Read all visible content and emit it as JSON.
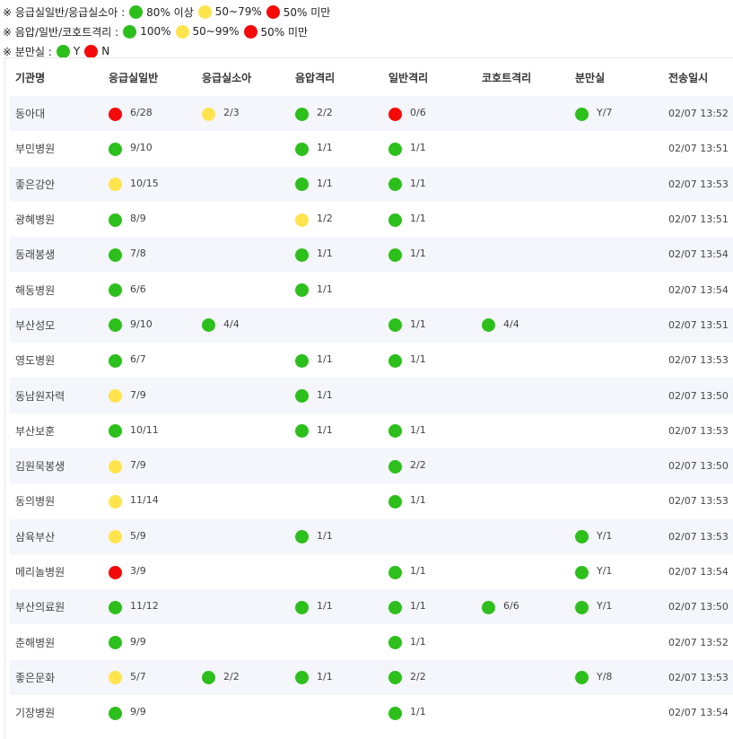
{
  "colors": {
    "green": "#2dbf1c",
    "yellow": "#ffe44d",
    "red": "#f50a0a"
  },
  "legend": [
    {
      "title": "※ 응급실일반/응급실소아 :",
      "items": [
        {
          "color": "green",
          "label": "80% 이상"
        },
        {
          "color": "yellow",
          "label": "50~79%"
        },
        {
          "color": "red",
          "label": "50% 미만"
        }
      ]
    },
    {
      "title": "※ 음압/일반/코호트격리 :",
      "items": [
        {
          "color": "green",
          "label": "100%"
        },
        {
          "color": "yellow",
          "label": "50~99%"
        },
        {
          "color": "red",
          "label": "50% 미만"
        }
      ]
    },
    {
      "title": "※ 분만실 :",
      "items": [
        {
          "color": "green",
          "label": "Y"
        },
        {
          "color": "red",
          "label": "N"
        }
      ]
    }
  ],
  "table": {
    "headers": [
      "기관명",
      "응급실일반",
      "응급실소아",
      "음압격리",
      "일반격리",
      "코호트격리",
      "분만실",
      "전송일시"
    ],
    "rows": [
      {
        "name": "동아대",
        "cells": [
          {
            "c": "red",
            "v": "6/28"
          },
          {
            "c": "yellow",
            "v": "2/3"
          },
          {
            "c": "green",
            "v": "2/2"
          },
          {
            "c": "red",
            "v": "0/6"
          },
          null,
          {
            "c": "green",
            "v": "Y/7"
          }
        ],
        "time": "02/07 13:52"
      },
      {
        "name": "부민병원",
        "cells": [
          {
            "c": "green",
            "v": "9/10"
          },
          null,
          {
            "c": "green",
            "v": "1/1"
          },
          {
            "c": "green",
            "v": "1/1"
          },
          null,
          null
        ],
        "time": "02/07 13:51"
      },
      {
        "name": "좋은강안",
        "cells": [
          {
            "c": "yellow",
            "v": "10/15"
          },
          null,
          {
            "c": "green",
            "v": "1/1"
          },
          {
            "c": "green",
            "v": "1/1"
          },
          null,
          null
        ],
        "time": "02/07 13:53"
      },
      {
        "name": "광혜병원",
        "cells": [
          {
            "c": "green",
            "v": "8/9"
          },
          null,
          {
            "c": "yellow",
            "v": "1/2"
          },
          {
            "c": "green",
            "v": "1/1"
          },
          null,
          null
        ],
        "time": "02/07 13:51"
      },
      {
        "name": "동래봉생",
        "cells": [
          {
            "c": "green",
            "v": "7/8"
          },
          null,
          {
            "c": "green",
            "v": "1/1"
          },
          {
            "c": "green",
            "v": "1/1"
          },
          null,
          null
        ],
        "time": "02/07 13:54"
      },
      {
        "name": "해동병원",
        "cells": [
          {
            "c": "green",
            "v": "6/6"
          },
          null,
          {
            "c": "green",
            "v": "1/1"
          },
          null,
          null,
          null
        ],
        "time": "02/07 13:54"
      },
      {
        "name": "부산성모",
        "cells": [
          {
            "c": "green",
            "v": "9/10"
          },
          {
            "c": "green",
            "v": "4/4"
          },
          null,
          {
            "c": "green",
            "v": "1/1"
          },
          {
            "c": "green",
            "v": "4/4"
          },
          null
        ],
        "time": "02/07 13:51"
      },
      {
        "name": "영도병원",
        "cells": [
          {
            "c": "green",
            "v": "6/7"
          },
          null,
          {
            "c": "green",
            "v": "1/1"
          },
          {
            "c": "green",
            "v": "1/1"
          },
          null,
          null
        ],
        "time": "02/07 13:53"
      },
      {
        "name": "동남원자력",
        "cells": [
          {
            "c": "yellow",
            "v": "7/9"
          },
          null,
          {
            "c": "green",
            "v": "1/1"
          },
          null,
          null,
          null
        ],
        "time": "02/07 13:50"
      },
      {
        "name": "부산보훈",
        "cells": [
          {
            "c": "green",
            "v": "10/11"
          },
          null,
          {
            "c": "green",
            "v": "1/1"
          },
          {
            "c": "green",
            "v": "1/1"
          },
          null,
          null
        ],
        "time": "02/07 13:53"
      },
      {
        "name": "김원묵봉생",
        "cells": [
          {
            "c": "yellow",
            "v": "7/9"
          },
          null,
          null,
          {
            "c": "green",
            "v": "2/2"
          },
          null,
          null
        ],
        "time": "02/07 13:50"
      },
      {
        "name": "동의병원",
        "cells": [
          {
            "c": "yellow",
            "v": "11/14"
          },
          null,
          null,
          {
            "c": "green",
            "v": "1/1"
          },
          null,
          null
        ],
        "time": "02/07 13:53"
      },
      {
        "name": "삼육부산",
        "cells": [
          {
            "c": "yellow",
            "v": "5/9"
          },
          null,
          {
            "c": "green",
            "v": "1/1"
          },
          null,
          null,
          {
            "c": "green",
            "v": "Y/1"
          }
        ],
        "time": "02/07 13:53"
      },
      {
        "name": "메리놀병원",
        "cells": [
          {
            "c": "red",
            "v": "3/9"
          },
          null,
          null,
          {
            "c": "green",
            "v": "1/1"
          },
          null,
          {
            "c": "green",
            "v": "Y/1"
          }
        ],
        "time": "02/07 13:54"
      },
      {
        "name": "부산의료원",
        "cells": [
          {
            "c": "green",
            "v": "11/12"
          },
          null,
          {
            "c": "green",
            "v": "1/1"
          },
          {
            "c": "green",
            "v": "1/1"
          },
          {
            "c": "green",
            "v": "6/6"
          },
          {
            "c": "green",
            "v": "Y/1"
          }
        ],
        "time": "02/07 13:50"
      },
      {
        "name": "춘해병원",
        "cells": [
          {
            "c": "green",
            "v": "9/9"
          },
          null,
          null,
          {
            "c": "green",
            "v": "1/1"
          },
          null,
          null
        ],
        "time": "02/07 13:52"
      },
      {
        "name": "좋은문화",
        "cells": [
          {
            "c": "yellow",
            "v": "5/7"
          },
          {
            "c": "green",
            "v": "2/2"
          },
          {
            "c": "green",
            "v": "1/1"
          },
          {
            "c": "green",
            "v": "2/2"
          },
          null,
          {
            "c": "green",
            "v": "Y/8"
          }
        ],
        "time": "02/07 13:53"
      },
      {
        "name": "기장병원",
        "cells": [
          {
            "c": "green",
            "v": "9/9"
          },
          null,
          null,
          {
            "c": "green",
            "v": "1/1"
          },
          null,
          null
        ],
        "time": "02/07 13:54"
      }
    ]
  }
}
